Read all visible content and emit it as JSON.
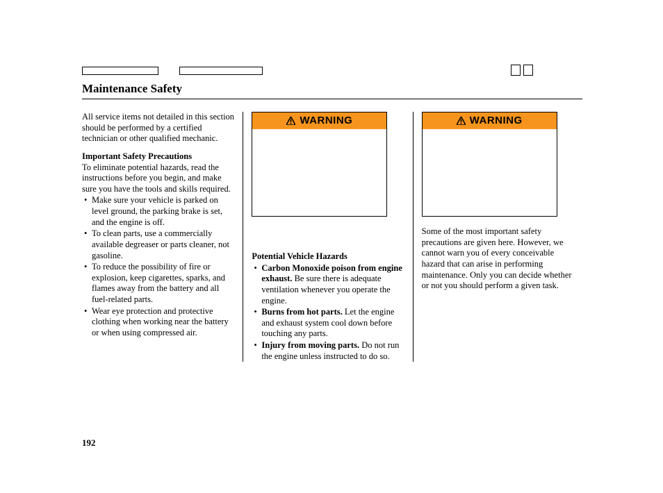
{
  "page": {
    "number": "192",
    "title": "Maintenance Safety"
  },
  "col1": {
    "intro": "All service items not detailed in this section should be performed by a certified technician or other qualified mechanic.",
    "precautions_heading": "Important Safety Precautions",
    "precautions_intro": "To eliminate potential hazards, read the instructions before you begin, and make sure you have the tools and skills required.",
    "bullets": [
      "Make sure your vehicle is parked on level ground, the parking brake is set, and the engine is off.",
      "To clean parts, use a commercially available degreaser or parts cleaner, not gasoline.",
      "To reduce the possibility of fire or explosion, keep cigarettes, sparks, and flames away from the battery and all fuel-related parts.",
      "Wear eye protection and protective clothing when working near the battery or when using compressed air."
    ]
  },
  "col2": {
    "warning_label": "WARNING",
    "hazards_heading": "Potential Vehicle Hazards",
    "hazards": [
      {
        "bold": "Carbon Monoxide poison from engine exhaust.",
        "rest": " Be sure there is adequate ventilation whenever you operate the engine."
      },
      {
        "bold": "Burns from hot parts.",
        "rest": " Let the engine and exhaust system cool down before touching any parts."
      },
      {
        "bold": "Injury from moving parts.",
        "rest": " Do not run the engine unless instructed to do so."
      }
    ]
  },
  "col3": {
    "warning_label": "WARNING",
    "text": "Some of the most important safety precautions are given here. However, we cannot warn you of every conceivable hazard that can arise in performing maintenance. Only you can decide whether or not you should perform a given task."
  }
}
